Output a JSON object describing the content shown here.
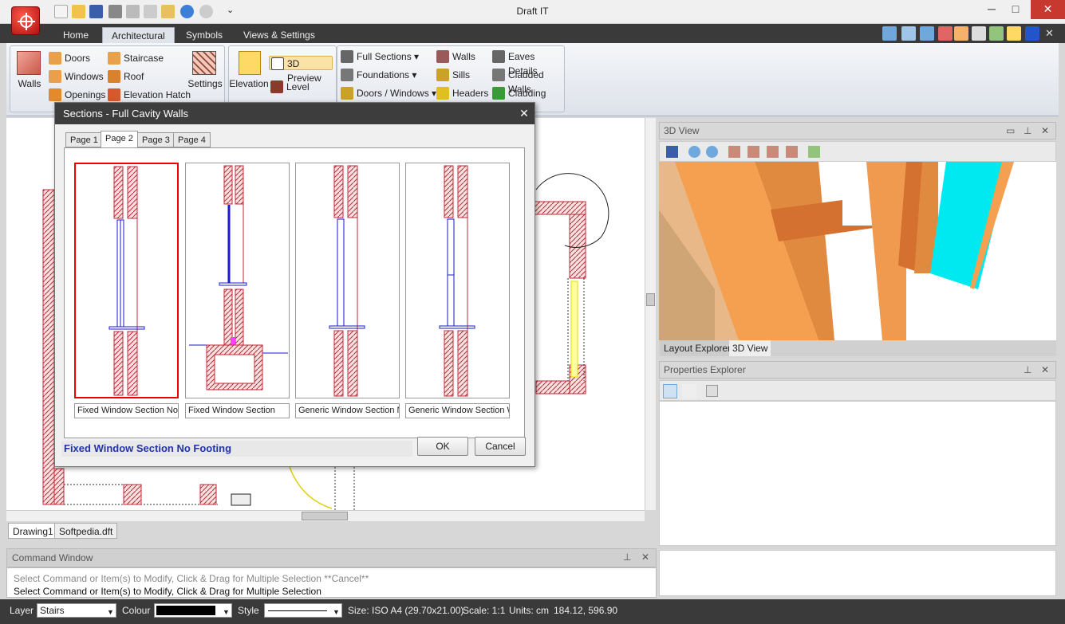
{
  "window": {
    "title": "Draft IT",
    "minimize": "─",
    "maximize": "□",
    "close": "✕"
  },
  "qat": {
    "dropdown": "⌄"
  },
  "ribbon_tabs": [
    {
      "label": "Home"
    },
    {
      "label": "Architectural"
    },
    {
      "label": "Symbols"
    },
    {
      "label": "Views & Settings"
    }
  ],
  "ribbon": {
    "walls_big": "Walls",
    "doors": "Doors",
    "windows": "Windows",
    "openings": "Openings",
    "staircase": "Staircase",
    "roof": "Roof",
    "elevation_hatch": "Elevation Hatch",
    "settings": "Settings",
    "elevation": "Elevation",
    "preview_3d": "3D Preview",
    "level": "Level",
    "full_sections": "Full Sections",
    "foundations": "Foundations",
    "doors_windows": "Doors / Windows",
    "walls2": "Walls",
    "sills": "Sills",
    "headers": "Headers",
    "eaves_details": "Eaves Details",
    "cladded_walls": "Cladded Walls",
    "cladding": "Cladding"
  },
  "doc_tabs": [
    {
      "label": "Drawing1"
    },
    {
      "label": "Softpedia.dft"
    }
  ],
  "command_window": {
    "title": "Command Window",
    "line1": "Select Command or Item(s) to Modify, Click & Drag for Multiple Selection  **Cancel**",
    "line2": "Select Command or Item(s) to Modify, Click & Drag for Multiple Selection"
  },
  "panel_3d": {
    "title": "3D View"
  },
  "bottom_tabs": [
    {
      "label": "Layout Explorer"
    },
    {
      "label": "3D View"
    }
  ],
  "properties": {
    "title": "Properties Explorer"
  },
  "statusbar": {
    "layer_label": "Layer",
    "layer_value": "Stairs",
    "colour_label": "Colour",
    "style_label": "Style",
    "size": "Size: ISO A4 (29.70x21.00)",
    "scale": "Scale: 1:1",
    "units": "Units: cm",
    "coords": "184.12, 596.90"
  },
  "dialog": {
    "title": "Sections - Full Cavity Walls",
    "close": "✕",
    "tabs": [
      {
        "label": "Page 1"
      },
      {
        "label": "Page 2"
      },
      {
        "label": "Page 3"
      },
      {
        "label": "Page 4"
      }
    ],
    "items": [
      {
        "label": "Fixed Window Section No"
      },
      {
        "label": "Fixed Window Section"
      },
      {
        "label": "Generic Window Section N"
      },
      {
        "label": "Generic Window Section W"
      }
    ],
    "selected_name": "Fixed Window Section No Footing",
    "ok": "OK",
    "cancel": "Cancel"
  },
  "colors": {
    "accent_red": "#dd0000",
    "dark_bar": "#3a3a3a",
    "brick": "#c0283a"
  }
}
